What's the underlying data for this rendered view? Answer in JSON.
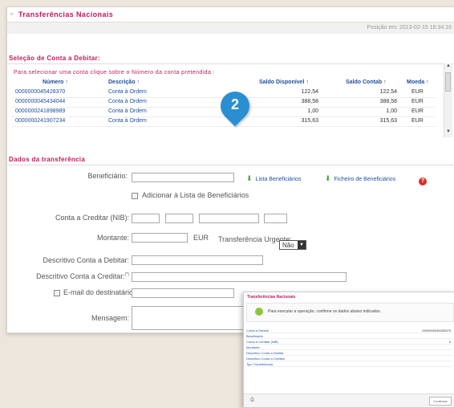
{
  "panel": {
    "title": "Transferências Nacionais",
    "position_text": "Posição em: 2013-02-15 16:34:16"
  },
  "select_account": {
    "section_title": "Seleção de Conta a Debitar:",
    "instruction": "Para selecionar uma conta clique sobre o Número da conta pretendida :",
    "headers": [
      "Número ↑",
      "Descrição ↑",
      "Saldo Disponível ↑",
      "Saldo Contab ↑",
      "Moeda ↑"
    ],
    "rows": [
      {
        "numero": "0000000045428370",
        "descricao": "Conta à Ordem",
        "saldo_disp": "122,54",
        "saldo_contab": "122,54",
        "moeda": "EUR"
      },
      {
        "numero": "0000000045434044",
        "descricao": "Conta à Ordem",
        "saldo_disp": "388,58",
        "saldo_contab": "388,58",
        "moeda": "EUR"
      },
      {
        "numero": "0000000241898989",
        "descricao": "Conta à Ordem",
        "saldo_disp": "1,00",
        "saldo_contab": "1,00",
        "moeda": "EUR"
      },
      {
        "numero": "0000000241907234",
        "descricao": "Conta à Ordem",
        "saldo_disp": "315,63",
        "saldo_contab": "315,63",
        "moeda": "EUR"
      }
    ]
  },
  "step_marker": "2",
  "transfer": {
    "section_title": "Dados da transferência",
    "beneficiario_label": "Beneficiário:",
    "lista_beneficiarios": "Lista Beneficiários",
    "ficheiro_beneficiarios": "Ficheiro de Beneficiários",
    "help_glyph": "?",
    "adicionar_lista": "Adicionar à Lista de Beneficiários",
    "conta_creditar_label": "Conta a Creditar (NIB):",
    "montante_label": "Montante:",
    "currency": "EUR",
    "urgente_label": "Transferência Urgente:",
    "urgente_value": "Não",
    "descritivo_debitar_label": "Descritivo Conta a Debitar:",
    "descritivo_creditar_label": "Descritivo Conta a Creditar:",
    "descritivo_creditar_sup": "(*)",
    "email_label": "E-mail do destinatário:",
    "mensagem_label": "Mensagem:"
  },
  "dialog": {
    "title": "Transferências Nacionais",
    "message": "Para executar a operação, confirme os dados abaixo indicados.",
    "rows": [
      {
        "label": "Conta a Debitar",
        "value": "0000000045428370"
      },
      {
        "label": "Beneficiário",
        "value": ""
      },
      {
        "label": "Conta a Creditar (NIB)",
        "value": "0"
      },
      {
        "label": "Montante",
        "value": ""
      },
      {
        "label": "Descritivo Conta a Debitar",
        "value": ""
      },
      {
        "label": "Descritivo Conta a Creditar",
        "value": ""
      },
      {
        "label": "Tipo Transferência",
        "value": ""
      }
    ],
    "confirm_button": "Confirmar",
    "print_icon": "printer-icon"
  },
  "colors": {
    "accent": "#c2185b",
    "link": "#1f4e9b",
    "marker": "#2a8fd1",
    "background": "#ede6dd"
  }
}
